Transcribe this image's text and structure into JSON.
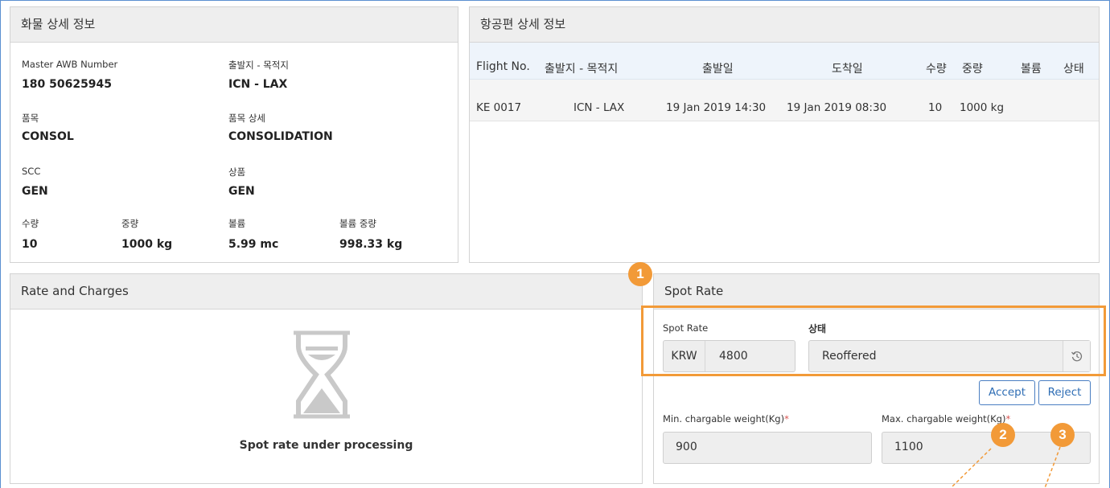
{
  "cargo": {
    "title": "화물 상세 정보",
    "awb_label": "Master AWB Number",
    "awb_value": "180 50625945",
    "route_label": "출발지 - 목적지",
    "route_value": "ICN - LAX",
    "item_label": "품목",
    "item_value": "CONSOL",
    "item_detail_label": "품목 상세",
    "item_detail_value": "CONSOLIDATION",
    "scc_label": "SCC",
    "scc_value": "GEN",
    "product_label": "상품",
    "product_value": "GEN",
    "qty_label": "수량",
    "qty_value": "10",
    "weight_label": "중량",
    "weight_value": "1000 kg",
    "volume_label": "볼륨",
    "volume_value": "5.99 mc",
    "vol_weight_label": "볼륨 중량",
    "vol_weight_value": "998.33 kg"
  },
  "flight": {
    "title": "항공편 상세 정보",
    "headers": [
      "Flight No.",
      "출발지 - 목적지",
      "출발일",
      "도착일",
      "수량",
      "중량",
      "볼륨",
      "상태"
    ],
    "row": [
      "KE 0017",
      "ICN - LAX",
      "19 Jan 2019 14:30",
      "19 Jan 2019 08:30",
      "10",
      "1000 kg",
      "",
      ""
    ]
  },
  "rate": {
    "title": "Rate and Charges",
    "status_text": "Spot rate under processing"
  },
  "spot": {
    "title": "Spot Rate",
    "rate_label": "Spot Rate",
    "currency": "KRW",
    "amount": "4800",
    "status_label": "상태",
    "status_value": "Reoffered",
    "accept_label": "Accept",
    "reject_label": "Reject",
    "min_label": "Min. chargable weight(Kg)",
    "min_value": "900",
    "max_label": "Max. chargable weight(Kg)",
    "max_value": "1100",
    "required_mark": "*"
  },
  "callouts": [
    "1",
    "2",
    "3"
  ],
  "colors": {
    "callout": "#f29a38",
    "accent": "#2e6db4",
    "required": "#d9534f"
  }
}
